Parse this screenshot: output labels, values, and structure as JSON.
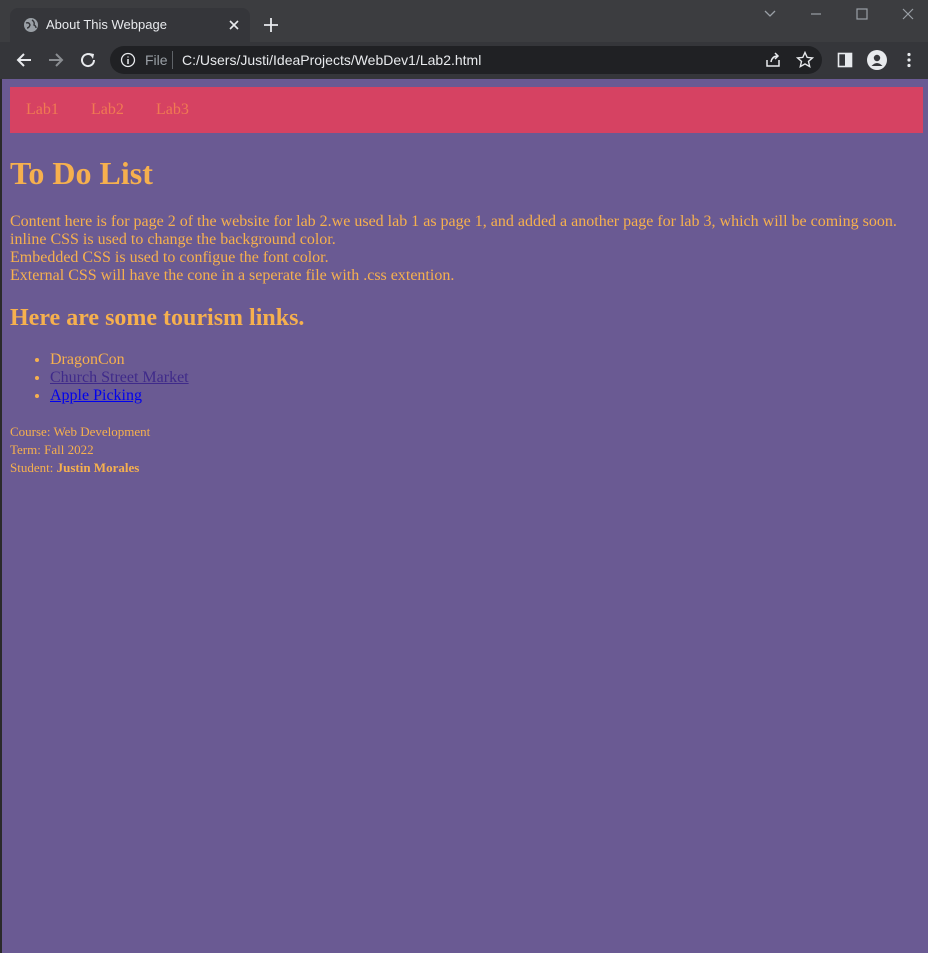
{
  "browser": {
    "tab_title": "About This Webpage",
    "file_label": "File",
    "url": "C:/Users/Justi/IdeaProjects/WebDev1/Lab2.html"
  },
  "site": {
    "nav": [
      "Lab1",
      "Lab2",
      "Lab3"
    ],
    "title": "To Do List",
    "intro_lines": [
      "Content here is for page 2 of the website for lab 2.we used lab 1 as page 1, and added a another page for lab 3, which will be coming soon.",
      "inline CSS is used to change the background color.",
      "Embedded CSS is used to configue the font color.",
      "External CSS will have the cone in a seperate file with .css extention."
    ],
    "links_heading": "Here are some tourism links.",
    "links": [
      {
        "label": "DragonCon"
      },
      {
        "label": "Church Street Market",
        "color": "#3f2a8a"
      },
      {
        "label": "Apple Picking",
        "color": "#0000ee"
      }
    ],
    "footer": {
      "course_label": "Course: Web Development",
      "term_label": "Term: Fall 2022",
      "student_prefix": "Student: ",
      "student_name": "Justin Morales"
    }
  },
  "colors": {
    "page_background": "#6a5a93",
    "text": "#f6b04e",
    "nav_background": "#d64262",
    "nav_link": "#f07a52"
  }
}
